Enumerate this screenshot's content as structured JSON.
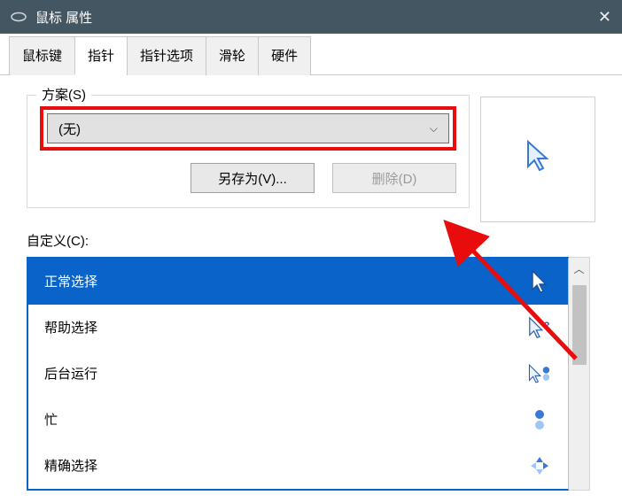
{
  "titlebar": {
    "title": "鼠标 属性"
  },
  "tabs": [
    {
      "label": "鼠标键"
    },
    {
      "label": "指针"
    },
    {
      "label": "指针选项"
    },
    {
      "label": "滑轮"
    },
    {
      "label": "硬件"
    }
  ],
  "active_tab_index": 1,
  "scheme": {
    "legend": "方案(S)",
    "selected": "(无)",
    "save_as_label": "另存为(V)...",
    "delete_label": "删除(D)"
  },
  "customize": {
    "label": "自定义(C):",
    "items": [
      {
        "label": "正常选择",
        "icon": "cursor-arrow",
        "selected": true
      },
      {
        "label": "帮助选择",
        "icon": "cursor-help"
      },
      {
        "label": "后台运行",
        "icon": "cursor-busy-bg"
      },
      {
        "label": "忙",
        "icon": "cursor-busy"
      },
      {
        "label": "精确选择",
        "icon": "cursor-precision"
      }
    ]
  }
}
